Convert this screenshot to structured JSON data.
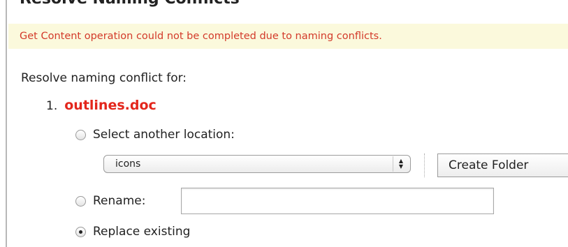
{
  "dialog": {
    "title": "Resolve Naming Conflicts",
    "notice": "Get Content operation could not be completed due to naming conflicts."
  },
  "conflicts": {
    "heading": "Resolve naming conflict for:",
    "item": {
      "number": "1.",
      "filename": "outlines.doc"
    },
    "options": {
      "select_location": {
        "label": "Select another location:",
        "checked": false
      },
      "location_value": "icons",
      "create_folder_label": "Create Folder",
      "rename": {
        "label": "Rename:",
        "value": "",
        "checked": false
      },
      "replace": {
        "label": "Replace existing",
        "checked": true
      }
    }
  },
  "colors": {
    "notice_background": "#fbf9dc",
    "notice_text": "#d33a2a",
    "filename": "#e3261c"
  }
}
